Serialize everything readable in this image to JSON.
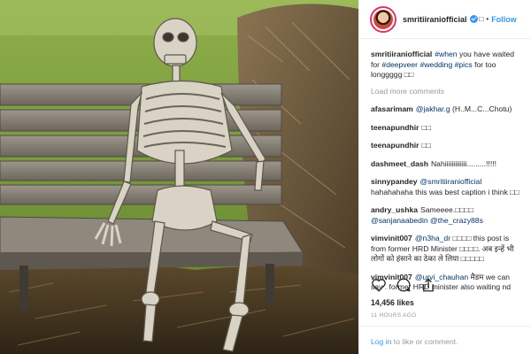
{
  "header": {
    "username": "smritiiraniofficial",
    "header_symbol": "□",
    "dot": "•",
    "follow_label": "Follow"
  },
  "caption": {
    "username": "smritiiraniofficial",
    "segments": [
      "#when",
      " you have waited for ",
      "#deepveer",
      " ",
      "#wedding",
      " ",
      "#pics",
      " for too longgggg □□"
    ]
  },
  "load_more_label": "Load more comments",
  "comments": [
    {
      "user": "afasarimam",
      "mention": "@jakhar.g",
      "text": " (H..M...C...Chotu)"
    },
    {
      "user": "teenapundhir",
      "text": "□□"
    },
    {
      "user": "teenapundhir",
      "text": "□□"
    },
    {
      "user": "dashmeet_dash",
      "text": "Nahiiiiiiiiiiiii.........!!!!!"
    },
    {
      "user": "sinnypandey",
      "mention": "@smritiiraniofficial",
      "text": " hahahahaha this was best caption i think □□"
    },
    {
      "user": "andry_ushka",
      "text": "Sameeee.□□□□ ",
      "mentions_after": [
        "@sanjanaabedin",
        "@the_crazy88s"
      ]
    },
    {
      "user": "vimvinit007",
      "mention": "@n3ha_dr",
      "text": " □□□□ this post is from former HRD Minister □□□□. अब इन्हें भी लोगों को हंसाने का ठेका ले लिया □□□□□"
    },
    {
      "user": "vimvinit007",
      "mention": "@urvi_chauhan",
      "text": " मैडम we can say . former HRD minister also waiting nd"
    }
  ],
  "likes_text": "14,456 likes",
  "time_text": "11 HOURS AGO",
  "login": {
    "link": "Log in",
    "rest": " to like or comment."
  },
  "icons": [
    "heart-icon",
    "comment-icon",
    "share-icon"
  ],
  "colors": {
    "link": "#3897f0",
    "hashtag": "#003569",
    "muted": "#999999"
  }
}
